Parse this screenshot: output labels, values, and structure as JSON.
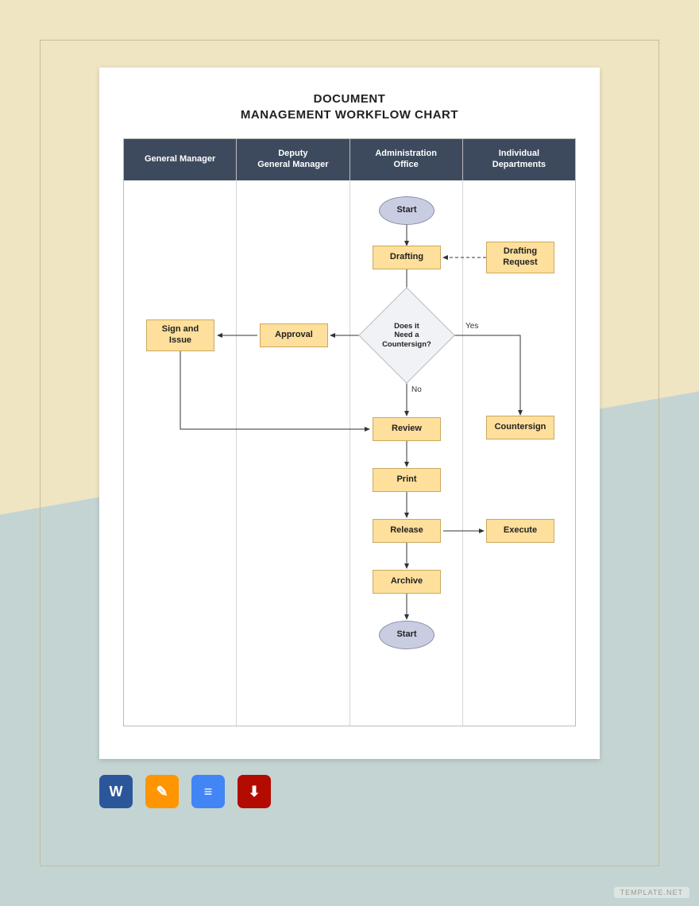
{
  "title_line1": "DOCUMENT",
  "title_line2": "MANAGEMENT WORKFLOW CHART",
  "lanes": [
    "General Manager",
    "Deputy\nGeneral Manager",
    "Administration\nOffice",
    "Individual\nDepartments"
  ],
  "nodes": {
    "start": "Start",
    "drafting": "Drafting",
    "drafting_request": "Drafting\nRequest",
    "decision": "Does it\nNeed a\nCountersign?",
    "yes": "Yes",
    "no": "No",
    "approval": "Approval",
    "sign_issue": "Sign and\nIssue",
    "countersign": "Countersign",
    "review": "Review",
    "print": "Print",
    "release": "Release",
    "execute": "Execute",
    "archive": "Archive",
    "end": "Start"
  },
  "icons": {
    "word": "W",
    "pages": "✎",
    "docs": "≡",
    "pdf": "⬇"
  },
  "watermark": "TEMPLATE.NET"
}
